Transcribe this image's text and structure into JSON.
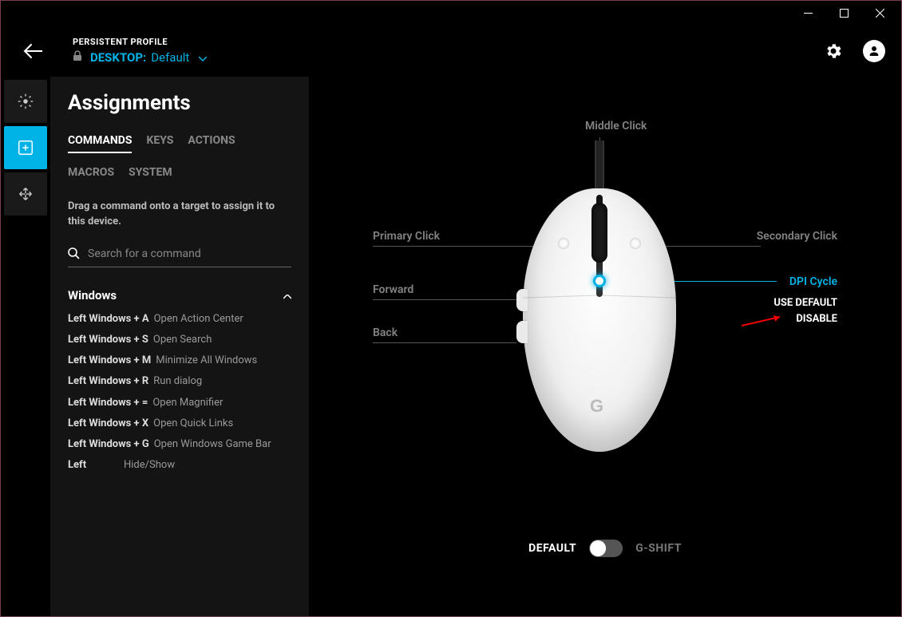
{
  "header": {
    "profile_label": "PERSISTENT PROFILE",
    "profile_prefix": "DESKTOP:",
    "profile_name": "Default"
  },
  "panel": {
    "title": "Assignments",
    "tabs": [
      "COMMANDS",
      "KEYS",
      "ACTIONS",
      "MACROS",
      "SYSTEM"
    ],
    "active_tab": "COMMANDS",
    "hint": "Drag a command onto a target to assign it to this device.",
    "search_placeholder": "Search for a command",
    "group": "Windows",
    "commands": [
      {
        "key": "Left Windows + A",
        "desc": "Open Action Center"
      },
      {
        "key": "Left Windows + S",
        "desc": "Open Search"
      },
      {
        "key": "Left Windows + M",
        "desc": "Minimize All Windows"
      },
      {
        "key": "Left Windows + R",
        "desc": "Run dialog"
      },
      {
        "key": "Left Windows + =",
        "desc": "Open Magnifier"
      },
      {
        "key": "Left Windows + X",
        "desc": "Open Quick Links"
      },
      {
        "key": "Left Windows + G",
        "desc": "Open Windows Game Bar"
      },
      {
        "key": "Left",
        "desc": "Hide/Show"
      }
    ]
  },
  "mouse": {
    "labels": {
      "middle": "Middle Click",
      "primary": "Primary Click",
      "secondary": "Secondary Click",
      "forward": "Forward",
      "back": "Back",
      "dpi": "DPI Cycle"
    },
    "context_menu": {
      "use_default": "USE DEFAULT",
      "disable": "DISABLE"
    },
    "toggle": {
      "left": "DEFAULT",
      "right": "G-SHIFT"
    }
  },
  "colors": {
    "accent": "#00b3e6"
  }
}
